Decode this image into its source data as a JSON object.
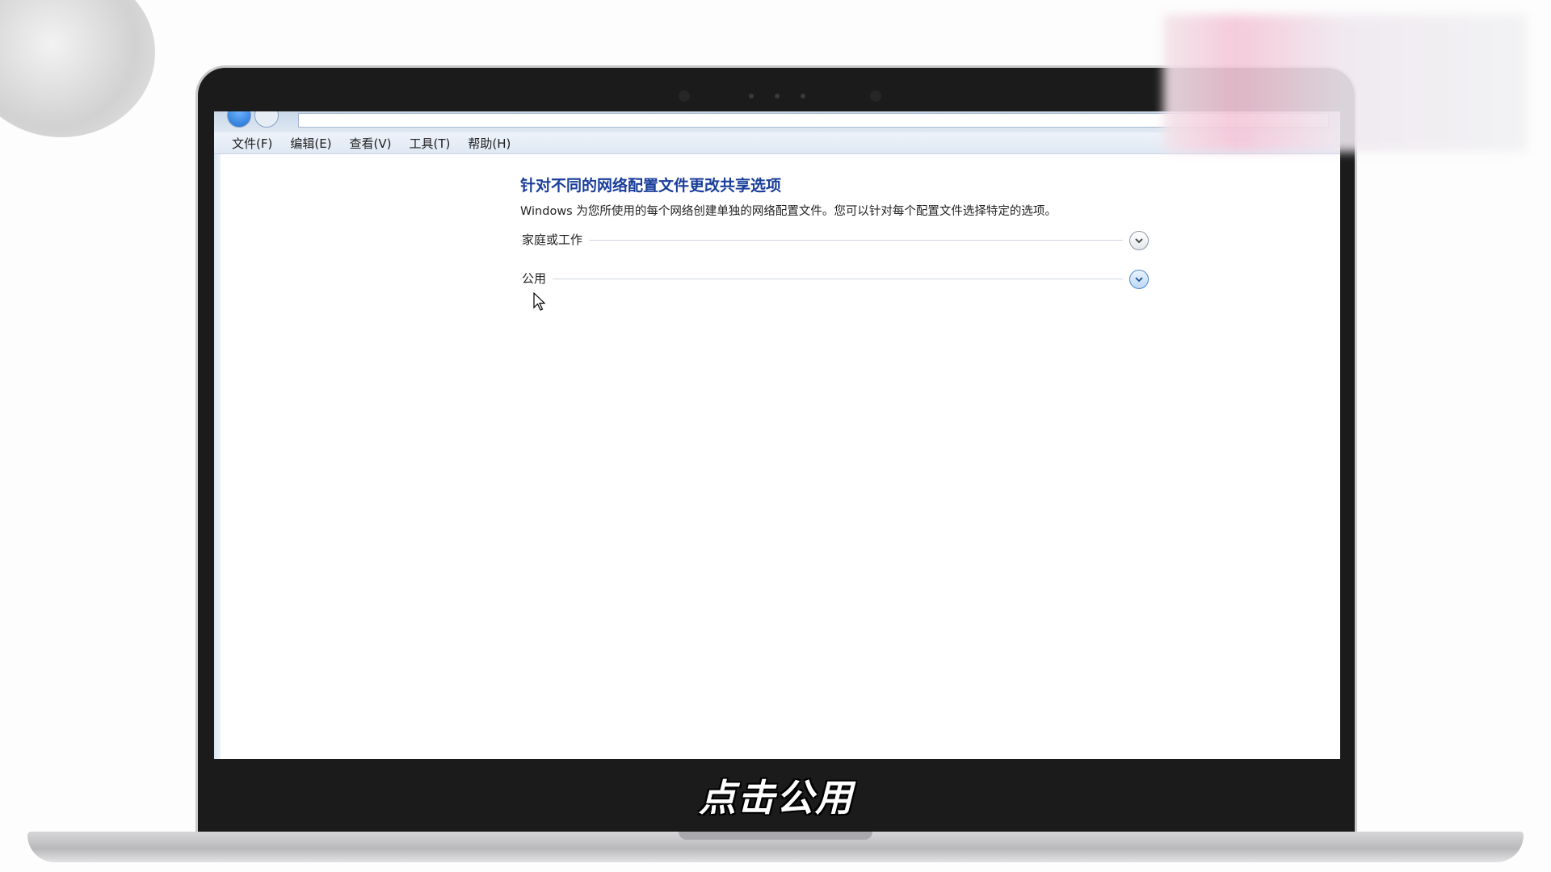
{
  "window": {
    "menu": [
      {
        "label": "文件(F)"
      },
      {
        "label": "编辑(E)"
      },
      {
        "label": "查看(V)"
      },
      {
        "label": "工具(T)"
      },
      {
        "label": "帮助(H)"
      }
    ]
  },
  "content": {
    "title": "针对不同的网络配置文件更改共享选项",
    "description": "Windows 为您所使用的每个网络创建单独的网络配置文件。您可以针对每个配置文件选择特定的选项。",
    "sections": [
      {
        "label": "家庭或工作",
        "expand_icon": "chevron-down-icon"
      },
      {
        "label": "公用",
        "expand_icon": "chevron-down-icon",
        "hovered": true
      }
    ]
  },
  "video": {
    "subtitle": "点击公用"
  },
  "colors": {
    "title_blue": "#1a3e9a",
    "accent_blue": "#4d86c7",
    "lid": "#1b1b1c"
  }
}
